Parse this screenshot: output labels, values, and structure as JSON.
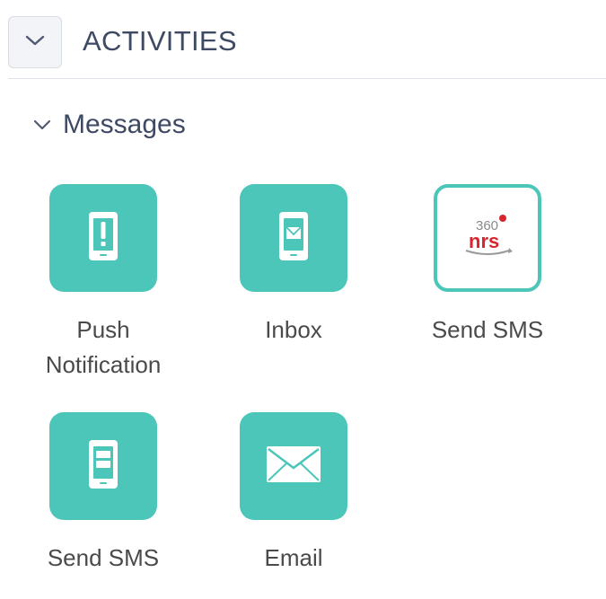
{
  "section": {
    "title": "ACTIVITIES",
    "toggle_icon": "chevron-down-icon"
  },
  "group": {
    "title": "Messages",
    "toggle_icon": "chevron-down-icon"
  },
  "tiles": [
    {
      "label": "Push Notification",
      "icon": "phone-alert-icon"
    },
    {
      "label": "Inbox",
      "icon": "phone-envelope-icon"
    },
    {
      "label": "Send SMS",
      "icon": "360nrs-logo-icon",
      "logo_text": "360 nrs"
    },
    {
      "label": "Send SMS",
      "icon": "phone-sms-icon"
    },
    {
      "label": "Email",
      "icon": "envelope-icon"
    }
  ],
  "colors": {
    "accent_teal": "#4bc6b9",
    "heading_text": "#3e4a63",
    "label_text": "#4a4a4a",
    "logo_red": "#d9252f"
  }
}
